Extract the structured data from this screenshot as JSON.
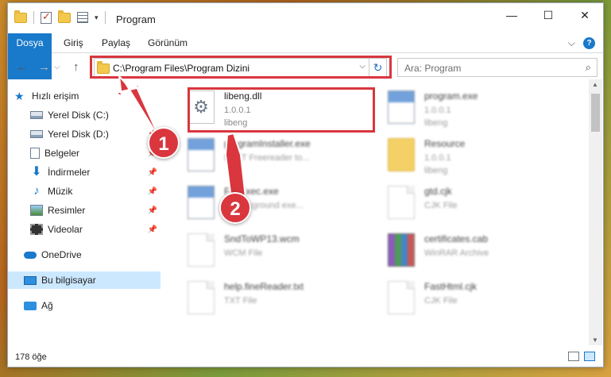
{
  "window": {
    "title": "Program",
    "controls": {
      "minimize": "—",
      "maximize": "☐",
      "close": "✕"
    }
  },
  "ribbon": {
    "tabs": [
      "Dosya",
      "Giriş",
      "Paylaş",
      "Görünüm"
    ],
    "expand_glyph": "⌵",
    "help_glyph": "?"
  },
  "navigation": {
    "back_glyph": "←",
    "forward_glyph": "→",
    "up_glyph": "↑",
    "dropdown_glyph": "⌵",
    "address_path": "C:\\Program Files\\Program Dizini",
    "refresh_glyph": "↻",
    "search_placeholder": "Ara: Program",
    "search_glyph": "⌕"
  },
  "sidebar": {
    "items": [
      {
        "label": "Hızlı erişim",
        "icon": "star-icon"
      },
      {
        "label": "Yerel Disk (C:)",
        "icon": "drive-icon"
      },
      {
        "label": "Yerel Disk (D:)",
        "icon": "drive-icon"
      },
      {
        "label": "Belgeler",
        "icon": "documents-icon"
      },
      {
        "label": "İndirmeler",
        "icon": "downloads-icon"
      },
      {
        "label": "Müzik",
        "icon": "music-icon"
      },
      {
        "label": "Resimler",
        "icon": "pictures-icon"
      },
      {
        "label": "Videolar",
        "icon": "videos-icon"
      },
      {
        "label": "OneDrive",
        "icon": "cloud-icon"
      },
      {
        "label": "Bu bilgisayar",
        "icon": "computer-icon",
        "selected": true
      },
      {
        "label": "Ağ",
        "icon": "network-icon"
      }
    ],
    "pin_glyph": "📌"
  },
  "files": [
    {
      "name": "libeng.dll",
      "line2": "1.0.0.1",
      "line3": "libeng",
      "icon": "dll-gear-icon",
      "clear": true
    },
    {
      "name": "program.exe",
      "line2": "1.0.0.1",
      "line3": "libeng",
      "icon": "exe-icon"
    },
    {
      "name": "programInstaller.exe",
      "line2": "BEST Freereader to...",
      "line3": "",
      "icon": "exe-icon"
    },
    {
      "name": "Resource",
      "line2": "1.0.0.1",
      "line3": "libeng",
      "icon": "folder-icon"
    },
    {
      "name": "FileExec.exe",
      "line2": "... background exe...",
      "line3": "",
      "icon": "exe-icon"
    },
    {
      "name": "gtd.cjk",
      "line2": "CJK File",
      "line3": "",
      "icon": "file-icon"
    },
    {
      "name": "SndToWP13.wcm",
      "line2": "WCM File",
      "line3": "",
      "icon": "file-icon"
    },
    {
      "name": "certificates.cab",
      "line2": "WinRAR Archive",
      "line3": "",
      "icon": "archive-icon"
    },
    {
      "name": "help.fineReader.txt",
      "line2": "TXT File",
      "line3": "",
      "icon": "file-icon"
    },
    {
      "name": "FastHtml.cjk",
      "line2": "CJK File",
      "line3": "",
      "icon": "file-icon"
    }
  ],
  "status": {
    "item_count": "178 öğe"
  },
  "callouts": {
    "first": "1",
    "second": "2"
  },
  "colors": {
    "accent": "#1979ca",
    "highlight": "#d9363e"
  }
}
